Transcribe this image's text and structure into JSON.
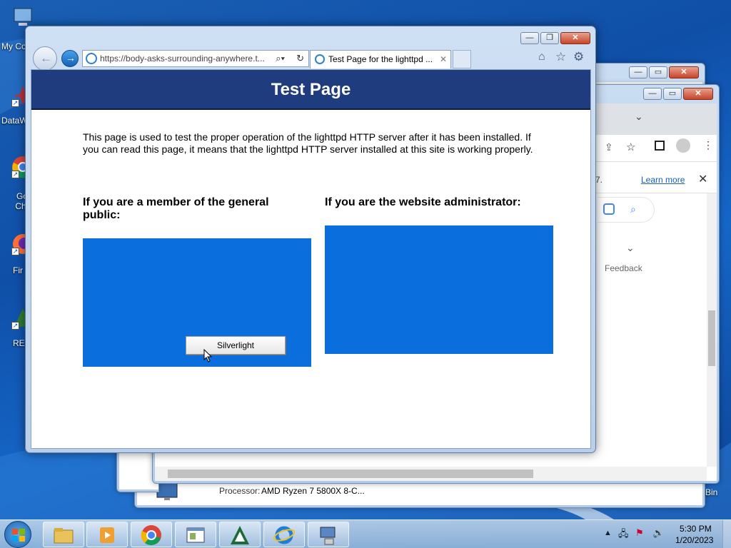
{
  "desktop": {
    "icons": [
      {
        "label": "My Co",
        "icon": "computer-icon"
      },
      {
        "label": "DataW",
        "icon": "dataw-icon"
      },
      {
        "label": "Go Chr",
        "icon": "chrome-icon"
      },
      {
        "label": "Fir",
        "icon": "firefox-icon"
      },
      {
        "label": "RE",
        "icon": "re-icon"
      }
    ],
    "bin_label": "Bin"
  },
  "chrome_window": {
    "banner_text": "7.",
    "learn_more": "Learn more",
    "feedback": "Feedback"
  },
  "system_window": {
    "processor_label": "Processor:",
    "processor_value": "AMD Ryzen 7 5800X 8-C..."
  },
  "ie": {
    "address_url": "https://body-asks-surrounding-anywhere.t...",
    "tab_title": "Test Page for the lighttpd ...",
    "page": {
      "title": "Test Page",
      "intro": "This page is used to test the proper operation of the lighttpd HTTP server after it has been installed. If you can read this page, it means that the lighttpd HTTP server installed at this site is working properly.",
      "public_heading": "If you are a member of the general public:",
      "admin_heading": "If you are the website administrator:",
      "silverlight_button": "Silverlight"
    }
  },
  "taskbar": {
    "apps": [
      "file-explorer-icon",
      "media-player-icon",
      "chrome-icon",
      "window-icon",
      "app-icon",
      "ie-icon",
      "network-icon"
    ],
    "time": "5:30 PM",
    "date": "1/20/2023"
  },
  "colors": {
    "page_header": "#1f3c7e",
    "blue_box": "#0a6fdc",
    "desktop": "#1a5fb4"
  }
}
